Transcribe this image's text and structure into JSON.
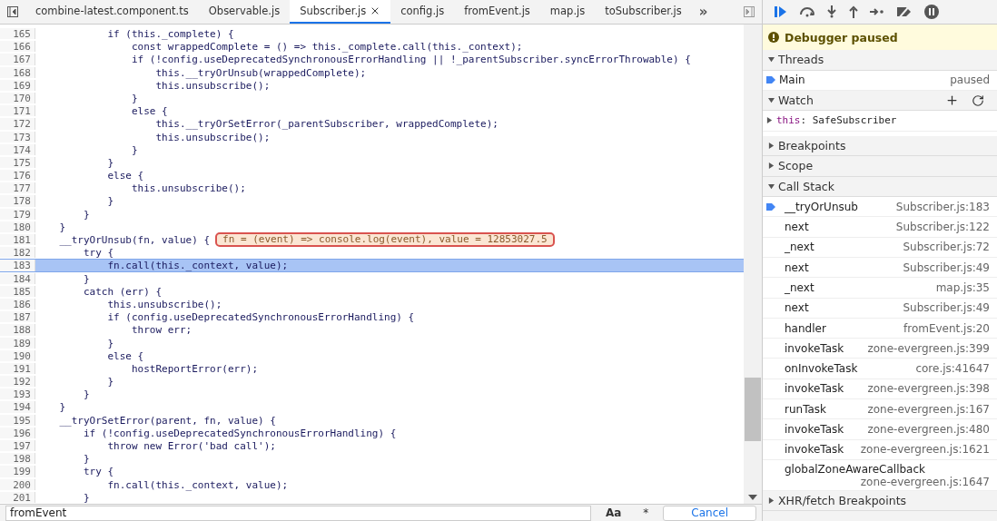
{
  "tabs": [
    {
      "label": "combine-latest.component.ts",
      "selected": false
    },
    {
      "label": "Observable.js",
      "selected": false
    },
    {
      "label": "Subscriber.js",
      "selected": true
    },
    {
      "label": "config.js",
      "selected": false
    },
    {
      "label": "fromEvent.js",
      "selected": false
    },
    {
      "label": "map.js",
      "selected": false
    },
    {
      "label": "toSubscriber.js",
      "selected": false
    }
  ],
  "more_tabs": "»",
  "code": [
    {
      "n": "165",
      "text": "            if (this._complete) {",
      "current": false
    },
    {
      "n": "166",
      "text": "                const wrappedComplete = () => this._complete.call(this._context);",
      "current": false
    },
    {
      "n": "167",
      "text": "                if (!config.useDeprecatedSynchronousErrorHandling || !_parentSubscriber.syncErrorThrowable) {",
      "current": false
    },
    {
      "n": "168",
      "text": "                    this.__tryOrUnsub(wrappedComplete);",
      "current": false
    },
    {
      "n": "169",
      "text": "                    this.unsubscribe();",
      "current": false
    },
    {
      "n": "170",
      "text": "                }",
      "current": false
    },
    {
      "n": "171",
      "text": "                else {",
      "current": false
    },
    {
      "n": "172",
      "text": "                    this.__tryOrSetError(_parentSubscriber, wrappedComplete);",
      "current": false
    },
    {
      "n": "173",
      "text": "                    this.unsubscribe();",
      "current": false
    },
    {
      "n": "174",
      "text": "                }",
      "current": false
    },
    {
      "n": "175",
      "text": "            }",
      "current": false
    },
    {
      "n": "176",
      "text": "            else {",
      "current": false
    },
    {
      "n": "177",
      "text": "                this.unsubscribe();",
      "current": false
    },
    {
      "n": "178",
      "text": "            }",
      "current": false
    },
    {
      "n": "179",
      "text": "        }",
      "current": false
    },
    {
      "n": "180",
      "text": "    }",
      "current": false
    },
    {
      "n": "181",
      "text": "    __tryOrUnsub(fn, value) {",
      "current": false,
      "inline_value": "fn = (event) => console.log(event), value = 12853027.5"
    },
    {
      "n": "182",
      "text": "        try {",
      "current": false
    },
    {
      "n": "183",
      "text": "            fn.call(this._context, value);",
      "current": true
    },
    {
      "n": "184",
      "text": "        }",
      "current": false
    },
    {
      "n": "185",
      "text": "        catch (err) {",
      "current": false
    },
    {
      "n": "186",
      "text": "            this.unsubscribe();",
      "current": false
    },
    {
      "n": "187",
      "text": "            if (config.useDeprecatedSynchronousErrorHandling) {",
      "current": false
    },
    {
      "n": "188",
      "text": "                throw err;",
      "current": false
    },
    {
      "n": "189",
      "text": "            }",
      "current": false
    },
    {
      "n": "190",
      "text": "            else {",
      "current": false
    },
    {
      "n": "191",
      "text": "                hostReportError(err);",
      "current": false
    },
    {
      "n": "192",
      "text": "            }",
      "current": false
    },
    {
      "n": "193",
      "text": "        }",
      "current": false
    },
    {
      "n": "194",
      "text": "    }",
      "current": false
    },
    {
      "n": "195",
      "text": "    __tryOrSetError(parent, fn, value) {",
      "current": false
    },
    {
      "n": "196",
      "text": "        if (!config.useDeprecatedSynchronousErrorHandling) {",
      "current": false
    },
    {
      "n": "197",
      "text": "            throw new Error('bad call');",
      "current": false
    },
    {
      "n": "198",
      "text": "        }",
      "current": false
    },
    {
      "n": "199",
      "text": "        try {",
      "current": false
    },
    {
      "n": "200",
      "text": "            fn.call(this._context, value);",
      "current": false
    },
    {
      "n": "201",
      "text": "        }",
      "current": false
    }
  ],
  "search": {
    "value": "fromEvent",
    "match_case": "Aa",
    "regex": "*",
    "cancel": "Cancel"
  },
  "paused_banner": "Debugger paused",
  "sections": [
    {
      "kind": "threads",
      "title": "Threads",
      "expanded": true,
      "items": [
        {
          "name": "Main",
          "status": "paused",
          "selected": true
        }
      ]
    },
    {
      "kind": "watch",
      "title": "Watch",
      "expanded": true,
      "items": [
        {
          "key": "this",
          "separator": ":",
          "value": "SafeSubscriber",
          "expanded": false
        }
      ]
    },
    {
      "kind": "plain",
      "title": "Breakpoints",
      "expanded": false
    },
    {
      "kind": "plain",
      "title": "Scope",
      "expanded": false
    },
    {
      "kind": "call_stack",
      "title": "Call Stack",
      "expanded": true,
      "frames": [
        {
          "fn": "__tryOrUnsub",
          "location": "Subscriber.js:183",
          "selected": true
        },
        {
          "fn": "next",
          "location": "Subscriber.js:122",
          "selected": false
        },
        {
          "fn": "_next",
          "location": "Subscriber.js:72",
          "selected": false
        },
        {
          "fn": "next",
          "location": "Subscriber.js:49",
          "selected": false
        },
        {
          "fn": "_next",
          "location": "map.js:35",
          "selected": false
        },
        {
          "fn": "next",
          "location": "Subscriber.js:49",
          "selected": false
        },
        {
          "fn": "handler",
          "location": "fromEvent.js:20",
          "selected": false
        },
        {
          "fn": "invokeTask",
          "location": "zone-evergreen.js:399",
          "selected": false
        },
        {
          "fn": "onInvokeTask",
          "location": "core.js:41647",
          "selected": false
        },
        {
          "fn": "invokeTask",
          "location": "zone-evergreen.js:398",
          "selected": false
        },
        {
          "fn": "runTask",
          "location": "zone-evergreen.js:167",
          "selected": false
        },
        {
          "fn": "invokeTask",
          "location": "zone-evergreen.js:480",
          "selected": false
        },
        {
          "fn": "invokeTask",
          "location": "zone-evergreen.js:1621",
          "selected": false
        },
        {
          "fn": "globalZoneAwareCallback",
          "location": "zone-evergreen.js:1647",
          "selected": false
        }
      ]
    },
    {
      "kind": "plain",
      "title": "XHR/fetch Breakpoints",
      "expanded": false
    }
  ]
}
